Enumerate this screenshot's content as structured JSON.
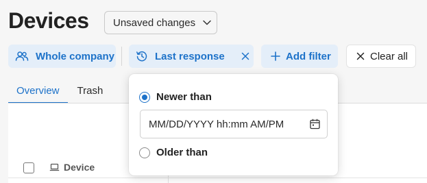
{
  "header": {
    "title": "Devices",
    "unsaved_label": "Unsaved changes"
  },
  "filters": {
    "company_label": "Whole company",
    "response_label": "Last response",
    "add_filter_label": "Add filter",
    "clear_all_label": "Clear all"
  },
  "tabs": [
    {
      "label": "Overview",
      "active": true
    },
    {
      "label": "Trash",
      "active": false
    }
  ],
  "table": {
    "columns": [
      "Device"
    ]
  },
  "popover": {
    "newer_label": "Newer than",
    "older_label": "Older than",
    "date_placeholder": "MM/DD/YYYY hh:mm AM/PM",
    "selected": "newer"
  },
  "icons": {
    "users": "users-icon",
    "history": "history-icon",
    "close": "close-icon",
    "plus": "plus-icon",
    "chevron": "chevron-down-icon",
    "calendar": "calendar-icon",
    "laptop": "laptop-icon"
  },
  "colors": {
    "accent": "#1d72c9",
    "chip_bg": "#e4eef9",
    "page_bg": "#f6f6f6"
  }
}
